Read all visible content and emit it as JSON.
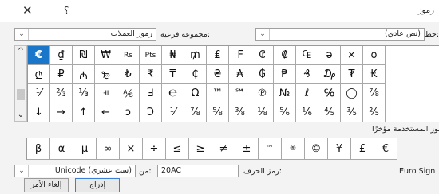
{
  "dialog": {
    "title": "رموز",
    "help_glyph": "؟",
    "close_glyph": "✕"
  },
  "font_combo": {
    "label": "خط:",
    "value": "(نص عادي)"
  },
  "subset_combo": {
    "label": "مجموعة فرعية:",
    "value": "رموز العملات"
  },
  "grid": {
    "rows": [
      [
        "€",
        "₫",
        "₪",
        "₩",
        "Rs",
        "Pts",
        "₦",
        "₥",
        "₤",
        "₣",
        "₢",
        "₡",
        "₠",
        "ə",
        "×",
        "ο"
      ],
      [
        "₾",
        "₽",
        "₼",
        "₻",
        "₺",
        "₹",
        "₸",
        "₵",
        "₴",
        "₳",
        "₲",
        "₱",
        "₰",
        "₯",
        "₮",
        "₭"
      ],
      [
        "⅟",
        "⅔",
        "⅓",
        "ℲI",
        "⅍",
        "Ⅎ",
        "℮",
        "Ω",
        "™",
        "℠",
        "℗",
        "№",
        "ℓ",
        "℅",
        "◯",
        "⅞"
      ],
      [
        "↓",
        "→",
        "↑",
        "←",
        "ɔ",
        "Ↄ",
        "⅟",
        "⅞",
        "⅝",
        "⅜",
        "⅛",
        "⅚",
        "⅙",
        "⅘",
        "⅗",
        "⅖"
      ]
    ],
    "selected": "€"
  },
  "recent": {
    "label": "الرموز المستخدمة مؤخرًا:",
    "symbols": [
      "β",
      "α",
      "µ",
      "∞",
      "×",
      "÷",
      "≤",
      "≥",
      "≠",
      "±",
      "™",
      "®",
      "©",
      "¥",
      "£",
      "€"
    ]
  },
  "char_name": "Euro Sign",
  "char_code": {
    "label": "رمز الحرف:",
    "value": "20AC"
  },
  "from_combo": {
    "label": "من:",
    "value": "Unicode (ست عشري)"
  },
  "buttons": {
    "insert": "إدراج",
    "cancel": "إلغاء الأمر"
  },
  "scroll": {
    "up": "^",
    "down": "⌄"
  }
}
